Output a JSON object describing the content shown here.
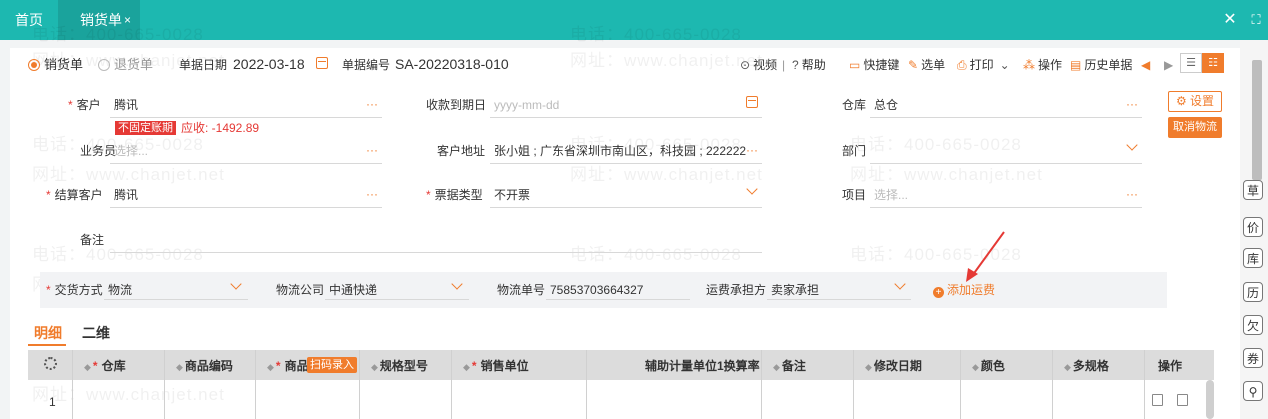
{
  "top_tabs": {
    "home": "首页",
    "active": "销货单",
    "active_close": "×",
    "window_close": "✕",
    "window_fullscreen": "⛶"
  },
  "header": {
    "radio_sales": "销货单",
    "radio_return": "退货单",
    "date_label": "单据日期",
    "date_value": "2022-03-18",
    "number_label": "单据编号",
    "number_value": "SA-20220318-010",
    "video": "视频",
    "help": "帮助",
    "shortcut": "快捷键",
    "select": "选单",
    "print": "打印",
    "operation": "操作",
    "history": "历史单据"
  },
  "form": {
    "customer_label": "客户",
    "customer_value": "腾讯",
    "badge_unfixed": "不固定账期",
    "receivable": "应收: -1492.89",
    "due_label": "收款到期日",
    "due_placeholder": "yyyy-mm-dd",
    "warehouse_label": "仓库",
    "warehouse_value": "总仓",
    "salesman_label": "业务员",
    "salesman_placeholder": "选择...",
    "address_label": "客户地址",
    "address_value": "张小姐 ; 广东省深圳市南山区，科技园 ; 222222",
    "dept_label": "部门",
    "settle_label": "结算客户",
    "settle_value": "腾讯",
    "invoice_label": "票据类型",
    "invoice_value": "不开票",
    "project_label": "项目",
    "project_placeholder": "选择...",
    "remark_label": "备注",
    "setting_btn": "设置",
    "cancel_logistics_btn": "取消物流"
  },
  "logistics": {
    "delivery_label": "交货方式",
    "delivery_value": "物流",
    "company_label": "物流公司",
    "company_value": "中通快递",
    "tracking_label": "物流单号",
    "tracking_value": "75853703664327",
    "freight_label": "运费承担方",
    "freight_value": "卖家承担",
    "add_fee": "添加运费",
    "add_fee_plus": "+"
  },
  "detail_tabs": [
    "明细",
    "二维"
  ],
  "table": {
    "scan_btn": "扫码录入",
    "columns": {
      "warehouse": "仓库",
      "code": "商品编码",
      "product": "商品",
      "spec": "规格型号",
      "unit": "销售单位",
      "ratio": "辅助计量单位1换算率",
      "note": "备注",
      "modified": "修改日期",
      "color": "颜色",
      "multi_spec": "多规格",
      "action": "操作"
    },
    "rows": [
      {
        "index": "1"
      }
    ]
  },
  "rail_icons": [
    "草",
    "价",
    "库",
    "历",
    "欠",
    "券",
    "⚲"
  ],
  "watermark": {
    "phone": "电话：400-665-0028",
    "site": "网址：www.chanjet.net"
  }
}
